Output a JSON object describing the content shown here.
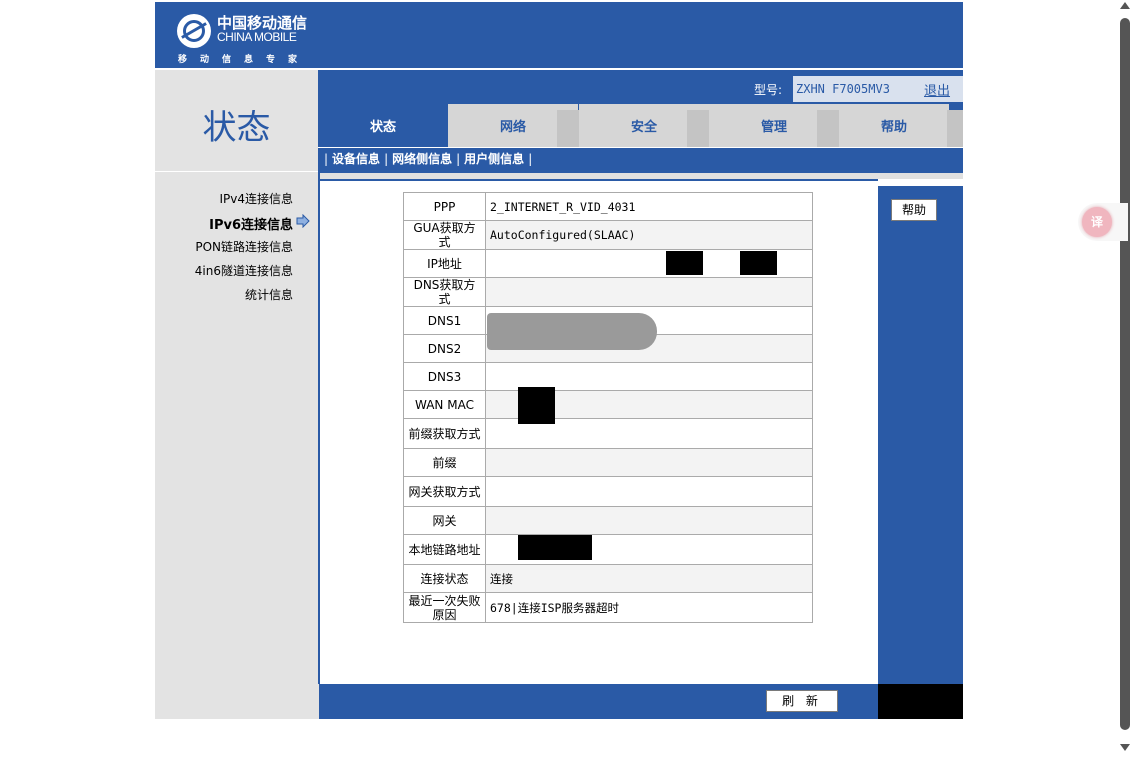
{
  "brand": {
    "name_cn": "中国移动通信",
    "name_en": "CHINA MOBILE",
    "tagline": "移动信息专家"
  },
  "page_title": "状态",
  "model": {
    "label": "型号:",
    "value": "ZXHN F7005MV3",
    "logout": "退出"
  },
  "tabs": [
    {
      "label": "状态",
      "active": true
    },
    {
      "label": "网络",
      "active": false
    },
    {
      "label": "安全",
      "active": false
    },
    {
      "label": "管理",
      "active": false
    },
    {
      "label": "帮助",
      "active": false
    }
  ],
  "subnav": [
    {
      "label": "设备信息"
    },
    {
      "label": "网络侧信息"
    },
    {
      "label": "用户侧信息"
    }
  ],
  "sidebar": {
    "items": [
      {
        "label": "IPv4连接信息",
        "active": false
      },
      {
        "label": "IPv6连接信息",
        "active": true
      },
      {
        "label": "PON链路连接信息",
        "active": false
      },
      {
        "label": "4in6隧道连接信息",
        "active": false
      },
      {
        "label": "统计信息",
        "active": false
      }
    ]
  },
  "help_button": "帮助",
  "refresh_button": "刷 新",
  "table": {
    "rows": [
      {
        "key": "PPP",
        "value": "2_INTERNET_R_VID_4031"
      },
      {
        "key": "GUA获取方式",
        "value": "AutoConfigured(SLAAC)"
      },
      {
        "key": "IP地址",
        "value": ""
      },
      {
        "key": "DNS获取方式",
        "value": ""
      },
      {
        "key": "DNS1",
        "value": ""
      },
      {
        "key": "DNS2",
        "value": ""
      },
      {
        "key": "DNS3",
        "value": ""
      },
      {
        "key": "WAN MAC",
        "value": ""
      },
      {
        "key": "前缀获取方式",
        "value": ""
      },
      {
        "key": "前缀",
        "value": ""
      },
      {
        "key": "网关获取方式",
        "value": ""
      },
      {
        "key": "网关",
        "value": ""
      },
      {
        "key": "本地链路地址",
        "value": ""
      },
      {
        "key": "连接状态",
        "value": "连接"
      },
      {
        "key": "最近一次失败原因",
        "value": "678|连接ISP服务器超时"
      }
    ]
  },
  "translate_widget": "译",
  "colors": {
    "primary": "#2a5aa6",
    "panel_grey": "#e3e3e3",
    "tab_grey": "#d6d6d6"
  }
}
